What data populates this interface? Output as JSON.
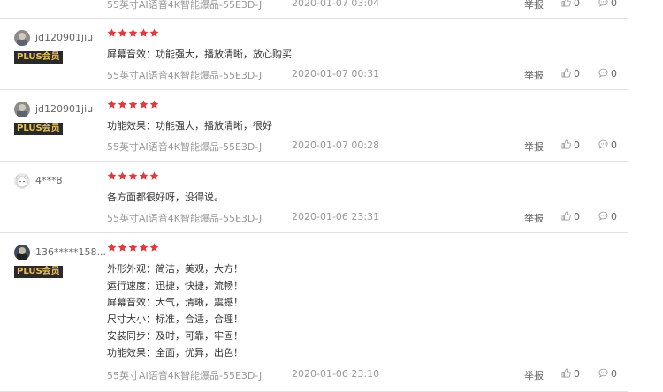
{
  "reviews": [
    {
      "product": "55英寸AI语音4K智能爆品-55E3D-J",
      "date": "2020-01-07 03:04",
      "report_label": "举报",
      "likes": "0",
      "comments": "0"
    },
    {
      "username": "jd120901jiu",
      "badge": "PLUS会员",
      "stars": 5,
      "lines": [
        "屏幕音效：功能强大，播放清晰，放心购买"
      ],
      "product": "55英寸AI语音4K智能爆品-55E3D-J",
      "date": "2020-01-07 00:31",
      "report_label": "举报",
      "likes": "0",
      "comments": "0"
    },
    {
      "username": "jd120901jiu",
      "badge": "PLUS会员",
      "stars": 5,
      "lines": [
        "功能效果：功能强大，播放清晰，很好"
      ],
      "product": "55英寸AI语音4K智能爆品-55E3D-J",
      "date": "2020-01-07 00:28",
      "report_label": "举报",
      "likes": "0",
      "comments": "0"
    },
    {
      "username": "4***8",
      "stars": 5,
      "lines": [
        "各方面都很好呀，没得说。"
      ],
      "product": "55英寸AI语音4K智能爆品-55E3D-J",
      "date": "2020-01-06 23:31",
      "report_label": "举报",
      "likes": "0",
      "comments": "0"
    },
    {
      "username": "136*****158...",
      "badge": "PLUS会员",
      "stars": 5,
      "lines": [
        "外形外观：简洁，美观，大方！",
        "运行速度：迅捷，快捷，流畅！",
        "屏幕音效：大气，清晰，震撼！",
        "尺寸大小：标准，合适，合理！",
        "安装同步：及时，可靠，牢固！",
        "功能效果：全面，优异，出色！"
      ],
      "product": "55英寸AI语音4K智能爆品-55E3D-J",
      "date": "2020-01-06 23:10",
      "report_label": "举报",
      "likes": "0",
      "comments": "0"
    }
  ],
  "colors": {
    "star": "#e4393c",
    "plus_bg": "#2a2a2a",
    "plus_text": "#e8c15b",
    "divider": "#e1e1e1"
  },
  "icons": {
    "like": "thumbs-up-icon",
    "comment": "comment-bubble-icon",
    "star": "star-icon"
  }
}
